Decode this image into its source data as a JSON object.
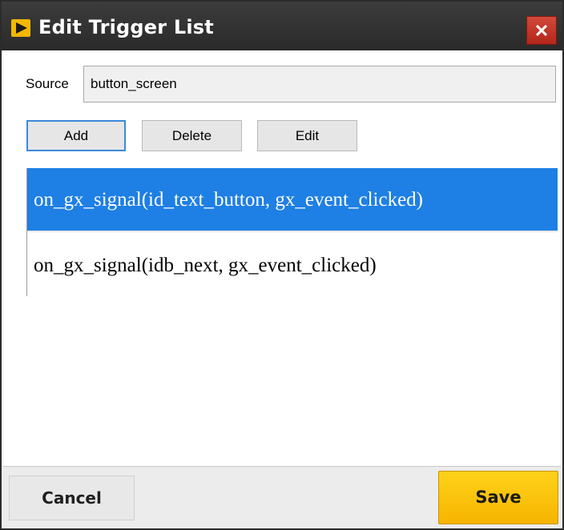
{
  "window": {
    "title": "Edit Trigger List",
    "icon": "play-arrow-icon",
    "close_icon": "close-icon"
  },
  "source": {
    "label": "Source",
    "value": "button_screen"
  },
  "toolbar": {
    "add_label": "Add",
    "delete_label": "Delete",
    "edit_label": "Edit"
  },
  "triggers": [
    {
      "text": "on_gx_signal(id_text_button, gx_event_clicked)",
      "selected": true
    },
    {
      "text": "on_gx_signal(idb_next, gx_event_clicked)",
      "selected": false
    }
  ],
  "footer": {
    "cancel_label": "Cancel",
    "save_label": "Save"
  },
  "colors": {
    "accent_selection": "#1e7fe4",
    "save_button": "#ffc60a",
    "titlebar": "#333333",
    "close_button": "#c0392b"
  }
}
